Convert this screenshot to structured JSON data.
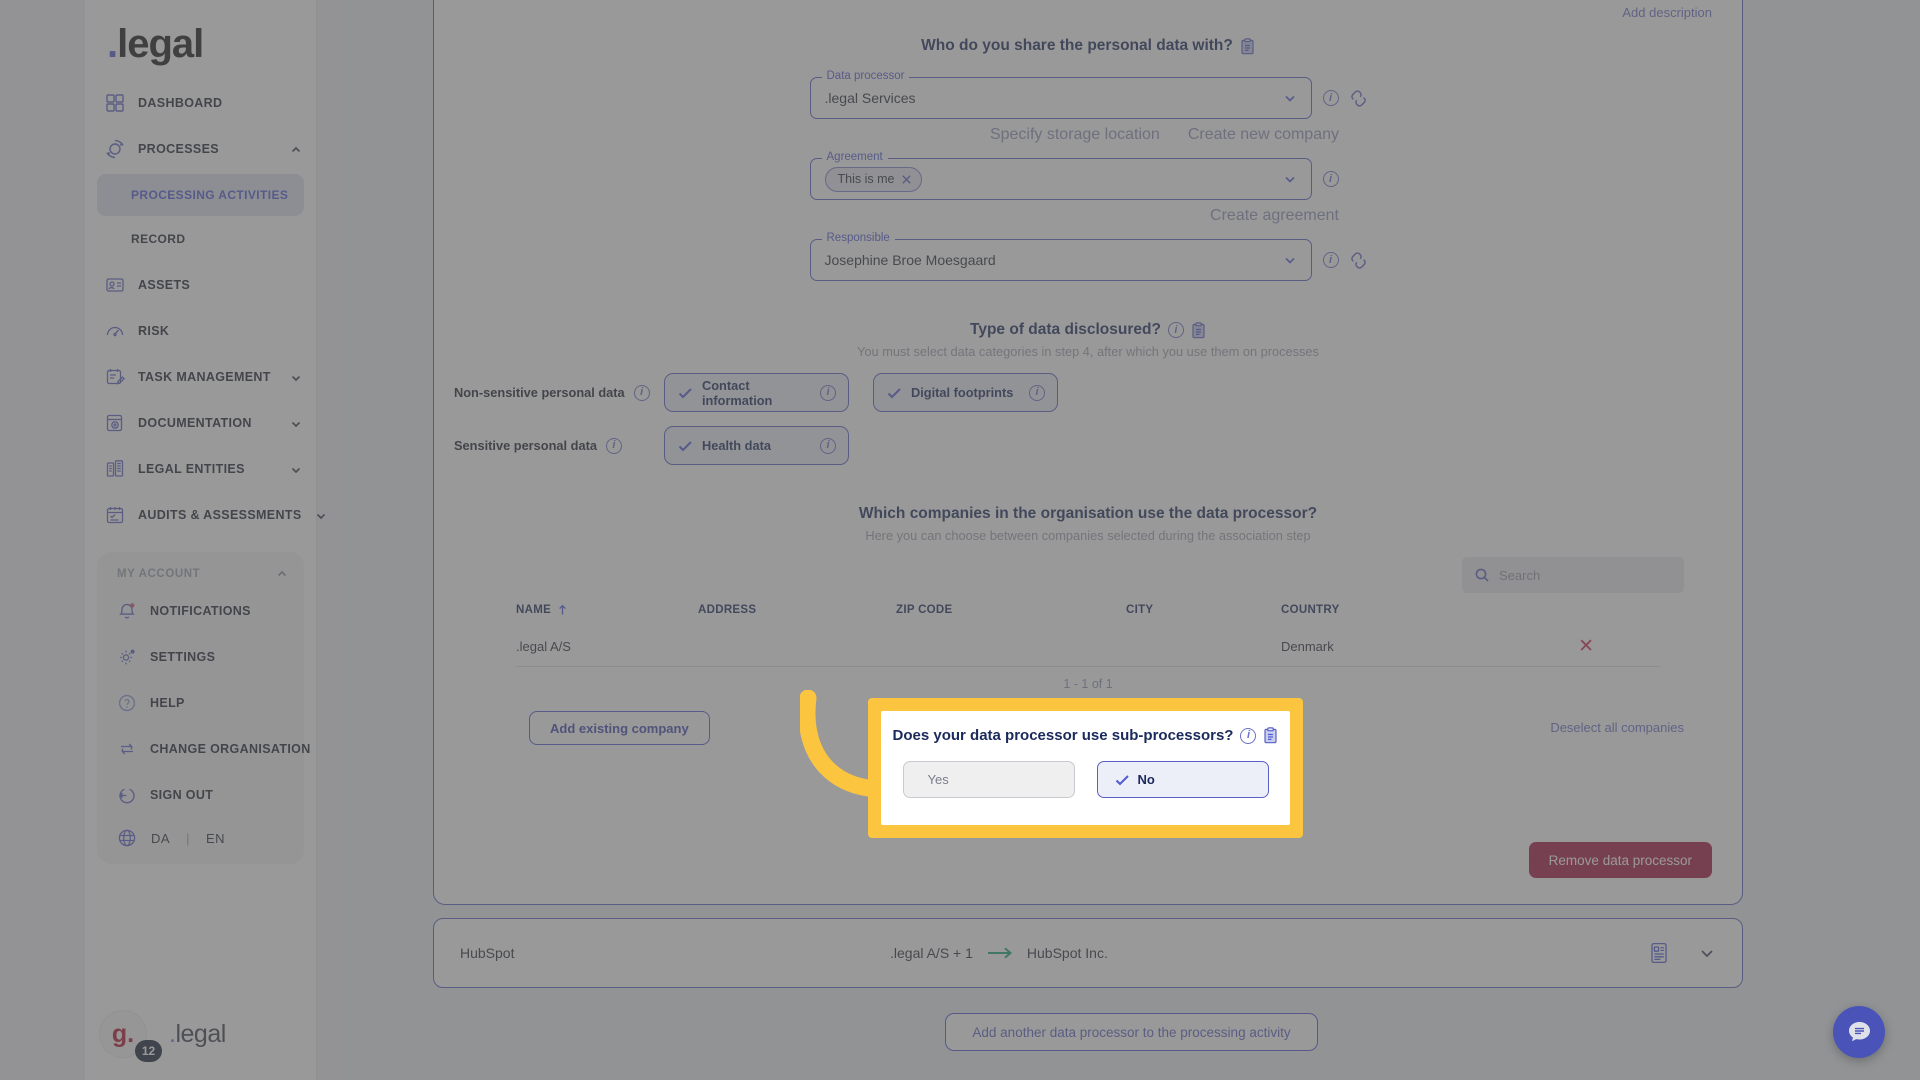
{
  "brand": {
    "name": ".legal",
    "dot": "."
  },
  "sidebar": {
    "items": [
      {
        "label": "DASHBOARD",
        "icon": "grid-icon",
        "expandable": false
      },
      {
        "label": "PROCESSES",
        "icon": "process-icon",
        "expandable": true,
        "expanded": true
      },
      {
        "label": "ASSETS",
        "icon": "assets-icon",
        "expandable": false
      },
      {
        "label": "RISK",
        "icon": "risk-gauge-icon",
        "expandable": false
      },
      {
        "label": "TASK MANAGEMENT",
        "icon": "task-icon",
        "expandable": true
      },
      {
        "label": "DOCUMENTATION",
        "icon": "documentation-icon",
        "expandable": true
      },
      {
        "label": "LEGAL ENTITIES",
        "icon": "legal-entities-icon",
        "expandable": true
      },
      {
        "label": "AUDITS & ASSESSMENTS",
        "icon": "audits-icon",
        "expandable": true
      }
    ],
    "sub_items": [
      {
        "label": "PROCESSING ACTIVITIES",
        "active": true
      },
      {
        "label": "RECORD",
        "active": false
      }
    ],
    "account": {
      "title": "MY ACCOUNT",
      "items": [
        {
          "label": "NOTIFICATIONS",
          "icon": "bell-icon",
          "has_dot": true
        },
        {
          "label": "SETTINGS",
          "icon": "gear-icon",
          "has_dot": true
        },
        {
          "label": "HELP",
          "icon": "help-icon",
          "has_dot": false
        },
        {
          "label": "CHANGE ORGANISATION",
          "icon": "swap-icon",
          "has_dot": false
        },
        {
          "label": "SIGN OUT",
          "icon": "sign-out-icon",
          "has_dot": false
        }
      ],
      "languages": {
        "icon": "globe-icon",
        "first": "DA",
        "separator": "|",
        "second": "EN"
      }
    },
    "user": {
      "initial": "g.",
      "badge": "12",
      "name": ".legal",
      "name_dot": "."
    }
  },
  "main": {
    "add_description": "Add description",
    "share_section": {
      "title": "Who do you share the personal data with?",
      "data_processor": {
        "legend": "Data processor",
        "value": ".legal Services"
      },
      "links_under_processor": [
        "Specify storage location",
        "Create new company"
      ],
      "agreement": {
        "legend": "Agreement",
        "chip": "This is me"
      },
      "link_under_agreement": "Create agreement",
      "responsible": {
        "legend": "Responsible",
        "value": "Josephine Broe Moesgaard"
      }
    },
    "disclosure_section": {
      "title": "Type of data disclosured?",
      "subtitle": "You must select data categories in step 4, after which you use them on processes",
      "rows": [
        {
          "label": "Non-sensitive personal data",
          "chips": [
            {
              "label": "Contact information",
              "selected": true
            },
            {
              "label": "Digital footprints",
              "selected": true
            }
          ]
        },
        {
          "label": "Sensitive personal data",
          "chips": [
            {
              "label": "Health data",
              "selected": true
            }
          ]
        }
      ]
    },
    "companies_section": {
      "title": "Which companies in the organisation use the data processor?",
      "subtitle": "Here you can choose between companies selected during the association step",
      "search_placeholder": "Search",
      "search_value": "",
      "columns": [
        "NAME",
        "ADDRESS",
        "ZIP CODE",
        "CITY",
        "COUNTRY"
      ],
      "sort_column": "NAME",
      "sort_direction": "asc",
      "rows": [
        {
          "name": ".legal A/S",
          "address": "",
          "zip_code": "",
          "city": "",
          "country": "Denmark"
        }
      ],
      "pagination": "1 - 1 of 1",
      "add_existing_company": "Add existing company",
      "deselect_all": "Deselect all companies"
    },
    "remove_button": "Remove data processor",
    "processor_row": {
      "name": "HubSpot",
      "source": ".legal A/S + 1",
      "target": "HubSpot Inc.",
      "arrow": "arrow-right-icon"
    },
    "add_another_processor": "Add another data processor to the processing activity",
    "chat_icon": "chat-bubble-icon"
  },
  "callout": {
    "title": "Does your data processor use sub-processors?",
    "options": [
      {
        "label": "Yes",
        "selected": false
      },
      {
        "label": "No",
        "selected": true
      }
    ],
    "highlight_color": "#fcc53f",
    "annotation": "curved-arrow-annotation"
  }
}
